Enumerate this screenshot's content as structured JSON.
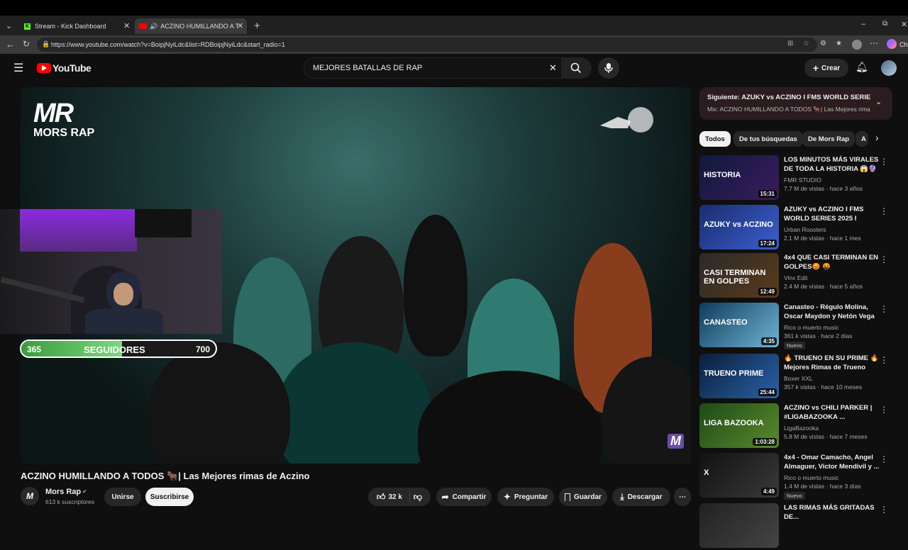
{
  "browser": {
    "tabs": [
      {
        "title": "Stream - Kick Dashboard",
        "active": false
      },
      {
        "title": "ACZINO HUMILLANDO A TO",
        "active": true
      }
    ],
    "url": "https://www.youtube.com/watch?v=BoipjNyiLdc&list=RDBoipjNyiLdc&start_radio=1",
    "profile_label": "Ch"
  },
  "header": {
    "logo_text": "YouTube",
    "search_value": "MEJORES BATALLAS DE RAP",
    "create_label": "Crear"
  },
  "video": {
    "overlay_logo_top": "MR",
    "overlay_logo_bottom": "MORS RAP",
    "followers_label": "SEGUIDORES",
    "followers_current": "365",
    "followers_goal": "700",
    "followers_progress": 0.52,
    "corner_mark": "M"
  },
  "details": {
    "title": "ACZINO HUMILLANDO A TODOS 🐂| Las Mejores rimas de Aczino",
    "channel_name": "Mors Rap",
    "subscribers": "613 k suscriptores",
    "join_label": "Unirse",
    "subscribe_label": "Suscribirse",
    "likes": "32 k",
    "share_label": "Compartir",
    "ask_label": "Preguntar",
    "save_label": "Guardar",
    "download_label": "Descargar"
  },
  "sidebar": {
    "up_next_prefix": "Siguiente:",
    "up_next_title": "AZUKY vs ACZINO I FMS WORLD SERIES...",
    "mix_title": "Mix: ACZINO HUMILLANDO A TODOS 🐂| Las Mejores rima...",
    "chips": [
      "Todos",
      "De tus búsquedas",
      "De Mors Rap",
      "A"
    ],
    "recommendations": [
      {
        "title": "LOS MINUTOS MÁS VIRALES DE TODA LA HISTORIA 😱🔮 |...",
        "channel": "FMR STUDIO",
        "meta": "7.7 M de vistas · hace 3 años",
        "duration": "15:31",
        "thumb_text": "HISTORIA",
        "badge": ""
      },
      {
        "title": "AZUKY vs ACZINO I FMS WORLD SERIES 2025 I Jornad...",
        "channel": "Urban Roosters",
        "meta": "2.1 M de vistas · hace 1 mes",
        "duration": "17:24",
        "thumb_text": "AZUKY vs ACZINO",
        "badge": ""
      },
      {
        "title": "4x4 QUE CASI TERMINAN EN GOLPES😡 🤬",
        "channel": "Vinx Edit",
        "meta": "2.4 M de vistas · hace 5 años",
        "duration": "12:49",
        "thumb_text": "CASI TERMINAN EN GOLPES",
        "badge": ""
      },
      {
        "title": "Canasteo - Régulo Molina, Oscar Maydon y Netón Vega ...",
        "channel": "Rico o muerto music",
        "meta": "361 k vistas · hace 2 días",
        "duration": "4:35",
        "thumb_text": "CANASTEO",
        "badge": "Nuevo"
      },
      {
        "title": "🔥 TRUENO EN SU PRIME 🔥 Mejores Rimas de Trueno",
        "channel": "Boxer XXL",
        "meta": "357 k vistas · hace 10 meses",
        "duration": "25:44",
        "thumb_text": "TRUENO PRIME",
        "badge": ""
      },
      {
        "title": "ACZINO vs CHILI PARKER | #LIGABAZOOKA ...",
        "channel": "LigaBazooka",
        "meta": "5.8 M de vistas · hace 7 meses",
        "duration": "1:03:28",
        "thumb_text": "LIGA BAZOOKA",
        "badge": ""
      },
      {
        "title": "4x4 - Omar Camacho, Angel Almaguer, Victor Mendivil y ...",
        "channel": "Rico o muerto music",
        "meta": "1.4 M de vistas · hace 3 días",
        "duration": "4:49",
        "thumb_text": "X",
        "badge": "Nuevo"
      },
      {
        "title": "LAS RIMAS MÁS GRITADAS DE...",
        "channel": "",
        "meta": "",
        "duration": "",
        "thumb_text": "",
        "badge": ""
      }
    ]
  },
  "colors": {
    "background": "#0f0f0f",
    "brand_red": "#ff0000",
    "follow_green": "#5bbf5b",
    "video_teal": "#3a6e6a"
  }
}
